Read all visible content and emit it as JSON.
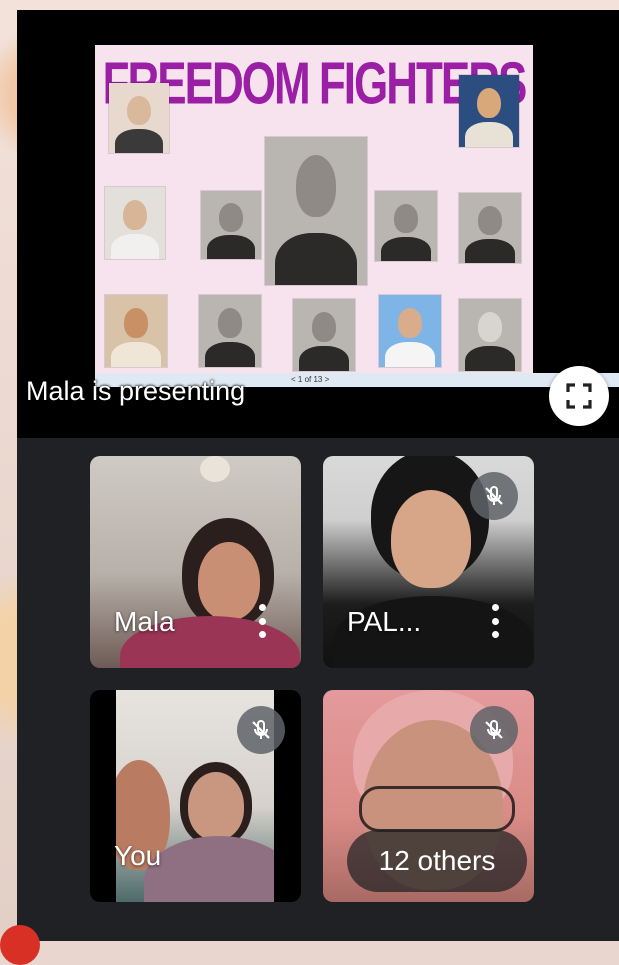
{
  "presentation": {
    "slide_title": "FREEDOM FIGHTERS",
    "page_indicator": "< 1 of 13 >",
    "presenting_text": "Mala is presenting"
  },
  "participants": [
    {
      "name": "Mala",
      "muted": false
    },
    {
      "name": "PAL...",
      "muted": true
    },
    {
      "name": "You",
      "muted": true
    },
    {
      "name": "",
      "muted": true
    }
  ],
  "others_label": "12 others",
  "colors": {
    "app_bg": "#202124",
    "title_purple": "#9a1fa4",
    "mute_badge": "#5f6368",
    "slide_bg": "#f7e3ee"
  },
  "icons": {
    "fullscreen": "fullscreen-icon",
    "mic_off": "mic-off-icon",
    "more": "more-vert-icon"
  }
}
